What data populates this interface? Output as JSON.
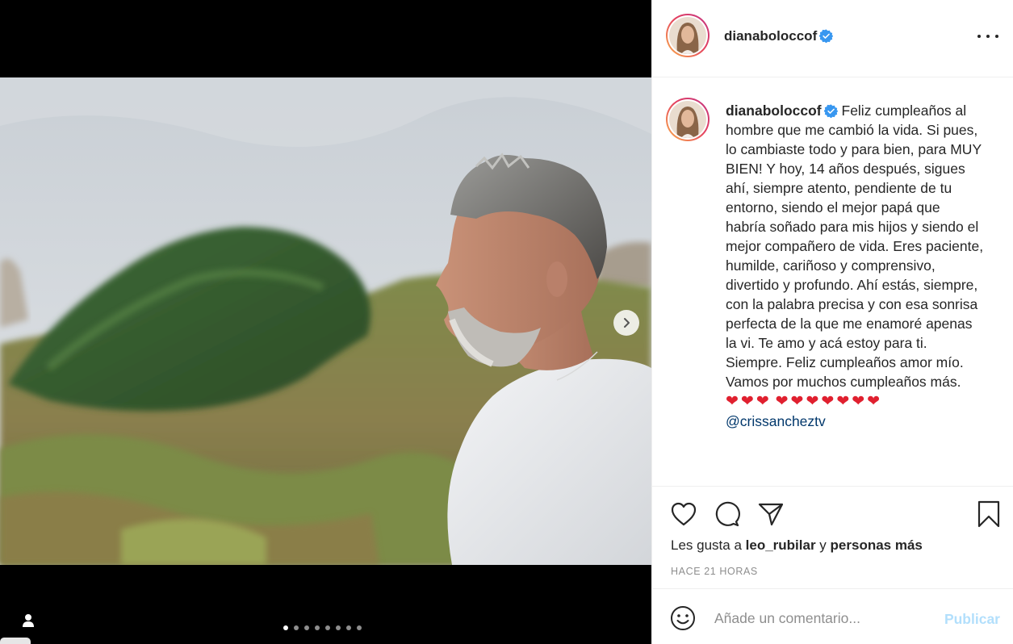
{
  "post": {
    "username": "dianaboloccof",
    "verified": true,
    "verified_icon": "verified-badge-icon",
    "more_icon": "more-options-icon"
  },
  "media": {
    "carousel_count": 8,
    "carousel_active_index": 0,
    "next_icon": "chevron-right-icon",
    "tag_icon": "user-tag-icon"
  },
  "caption": {
    "username": "dianaboloccof",
    "text": "Feliz cumpleaños al hombre que me cambió la vida. Si pues, lo cambiaste todo y para bien, para MUY BIEN! Y hoy, 14 años después, sigues ahí, siempre atento, pendiente de tu entorno, siendo el mejor papá que habría soñado para mis hijos y siendo el mejor compañero de vida. Eres paciente, humilde, cariñoso y comprensivo, divertido y profundo. Ahí estás, siempre, con la palabra precisa y con esa sonrisa perfecta de la que me enamoré apenas la vi. Te amo y acá estoy para ti. Siempre. Feliz cumpleaños amor mío. Vamos por muchos cumpleaños más.",
    "hearts_line1": "❤❤❤",
    "hearts_line2": "❤❤❤❤❤❤❤",
    "mention": "@crissancheztv"
  },
  "actions": {
    "like_icon": "heart-icon",
    "comment_icon": "comment-icon",
    "share_icon": "share-icon",
    "save_icon": "bookmark-icon"
  },
  "likes": {
    "prefix": "Les gusta a",
    "user": "leo_rubilar",
    "connector": "y",
    "others": "personas más"
  },
  "timestamp": "HACE 21 HORAS",
  "comment": {
    "emoji_icon": "emoji-icon",
    "placeholder": "Añade un comentario...",
    "publish_label": "Publicar"
  },
  "colors": {
    "accent": "#0095f6",
    "publish_disabled": "#b2dffc",
    "heart_emoji": "#e0202f",
    "mention": "#00376b",
    "muted": "#8e8e8e"
  }
}
